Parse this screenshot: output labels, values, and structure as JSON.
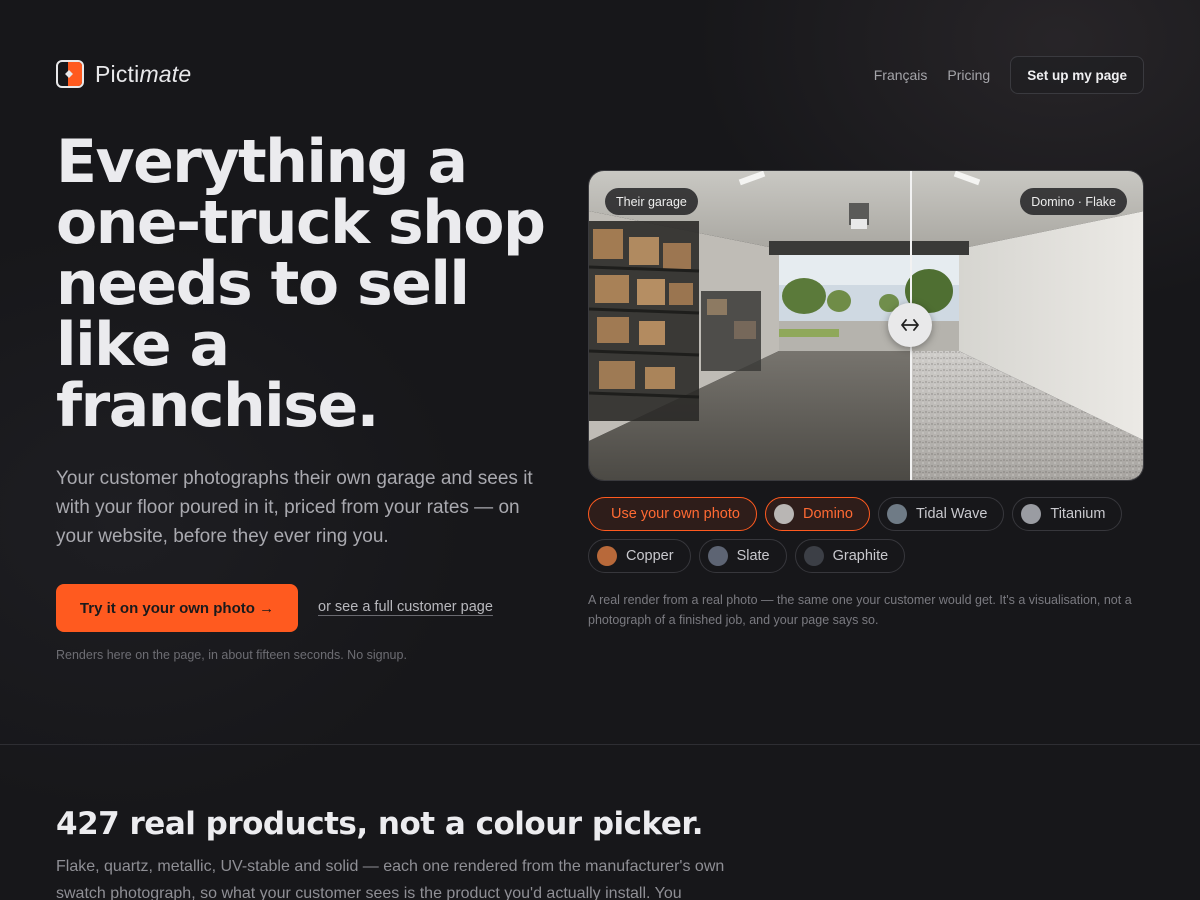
{
  "brand": {
    "name_plain": "Picti",
    "name_italic": "mate",
    "accent": "#ff5a1f"
  },
  "nav": {
    "links": [
      "Français",
      "Pricing"
    ],
    "button": "Set up my page"
  },
  "hero": {
    "headline": "Everything a one-truck shop needs to sell like a franchise.",
    "subtext": "Your customer photographs their own garage and sees it with your floor poured in it, priced from your rates — on your website, before they ever ring you.",
    "cta_label": "Try it on your own photo →",
    "secondary_link": "or see a full customer page",
    "fine_print": "Renders here on the page, in about fifteen seconds. No signup."
  },
  "compare": {
    "left_tag": "Their garage",
    "right_tag": "Domino · Flake",
    "handle_icon": "arrows-horizontal-icon",
    "split_fraction": 0.58
  },
  "swatches": {
    "own_photo_label": "Use your own photo",
    "items": [
      {
        "label": "Domino",
        "color": "#b9b6b4",
        "active": true
      },
      {
        "label": "Tidal Wave",
        "color": "#6f7b86",
        "active": false
      },
      {
        "label": "Titanium",
        "color": "#9a9ca2",
        "active": false
      },
      {
        "label": "Copper",
        "color": "#b8693a",
        "active": false
      },
      {
        "label": "Slate",
        "color": "#5d6473",
        "active": false
      },
      {
        "label": "Graphite",
        "color": "#3c3f46",
        "active": false
      }
    ]
  },
  "caption": "A real render from a real photo — the same one your customer would get. It's a visualisation, not a photograph of a finished job, and your page says so.",
  "section2": {
    "title": "427 real products, not a colour picker.",
    "body": "Flake, quartz, metallic, UV-stable and solid — each one rendered from the manufacturer's own swatch photograph, so what your customer sees is the product you'd actually install. You choose"
  }
}
